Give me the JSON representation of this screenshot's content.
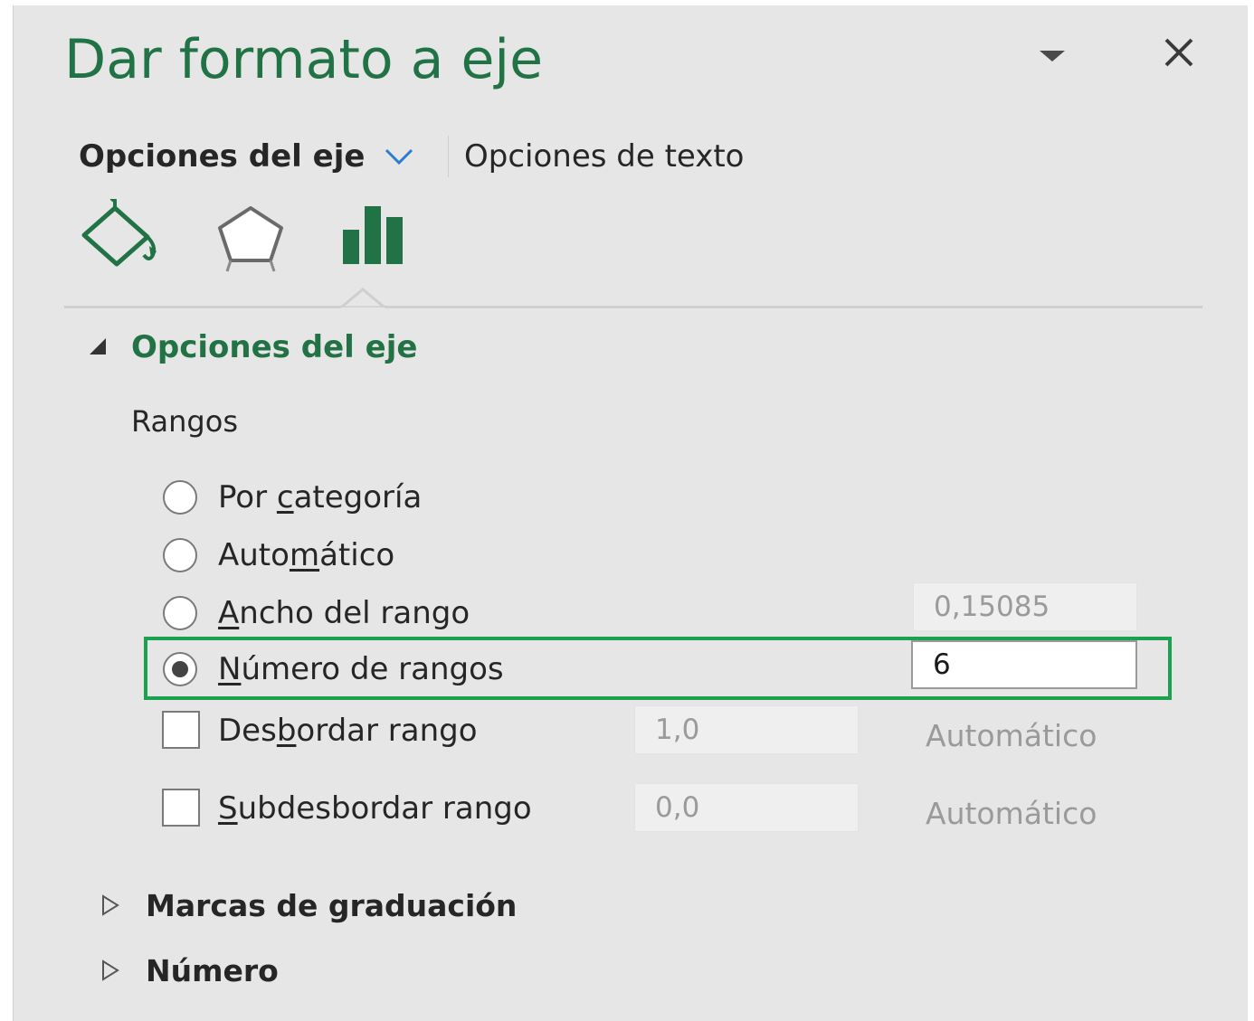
{
  "pane": {
    "title": "Dar formato a eje"
  },
  "tabs": {
    "axis_options": "Opciones del eje",
    "text_options": "Opciones de texto"
  },
  "icons": [
    "fill-line-icon",
    "effects-icon",
    "axis-options-icon"
  ],
  "section": {
    "title": "Opciones del eje",
    "subheading": "Rangos"
  },
  "bins": {
    "options": [
      {
        "label_pre": "Por ",
        "label_key": "c",
        "label_post": "ategoría",
        "selected": false
      },
      {
        "label_pre": "Auto",
        "label_key": "m",
        "label_post": "ático",
        "selected": false
      },
      {
        "label_pre": "",
        "label_key": "A",
        "label_post": "ncho del rango",
        "selected": false
      },
      {
        "label_pre": "",
        "label_key": "N",
        "label_post": "úmero de rangos",
        "selected": true
      }
    ],
    "bin_width_value": "0,15085",
    "bin_count_value": "6"
  },
  "overflow": {
    "label_pre": "Des",
    "label_key": "b",
    "label_post": "ordar rango",
    "checked": false,
    "value": "1,0",
    "auto_label": "Automático"
  },
  "underflow": {
    "label_pre": "",
    "label_key": "S",
    "label_post": "ubdesbordar rango",
    "checked": false,
    "value": "0,0",
    "auto_label": "Automático"
  },
  "collapsed_sections": {
    "tick_marks": "Marcas de graduación",
    "number": "Número"
  },
  "colors": {
    "accent_green": "#217346",
    "highlight_green": "#1aa24f",
    "pane_bg": "#e6e6e6",
    "chevron_blue": "#2b7cd3"
  }
}
